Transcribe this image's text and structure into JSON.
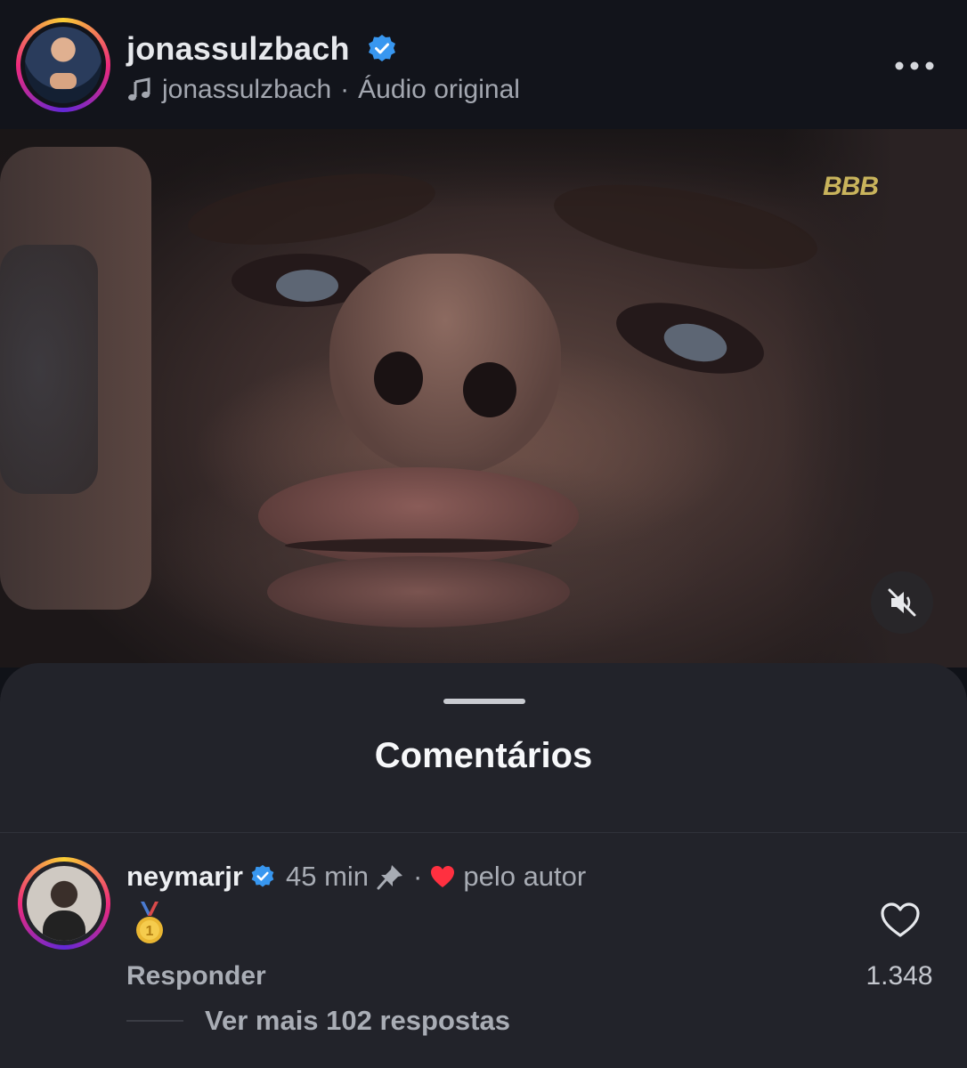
{
  "header": {
    "username": "jonassulzbach",
    "audio_user": "jonassulzbach",
    "audio_sep": "·",
    "audio_label": "Áudio original"
  },
  "video": {
    "watermark": "BBB",
    "muted": true
  },
  "comments_sheet": {
    "title": "Comentários",
    "comment": {
      "username": "neymarjr",
      "time": "45 min",
      "separator": "·",
      "liked_by": "pelo autor",
      "emoji": "🥇",
      "reply_label": "Responder",
      "like_count": "1.348",
      "more_replies": "Ver mais 102 respostas"
    }
  },
  "colors": {
    "verified": "#3897f0",
    "heart_liked": "#ff3040",
    "background": "#101218",
    "sheet": "#22232a"
  },
  "icons": [
    "verified-badge-icon",
    "music-note-icon",
    "more-options-icon",
    "mute-icon",
    "pin-icon",
    "red-heart-icon",
    "medal-icon",
    "like-heart-icon"
  ]
}
